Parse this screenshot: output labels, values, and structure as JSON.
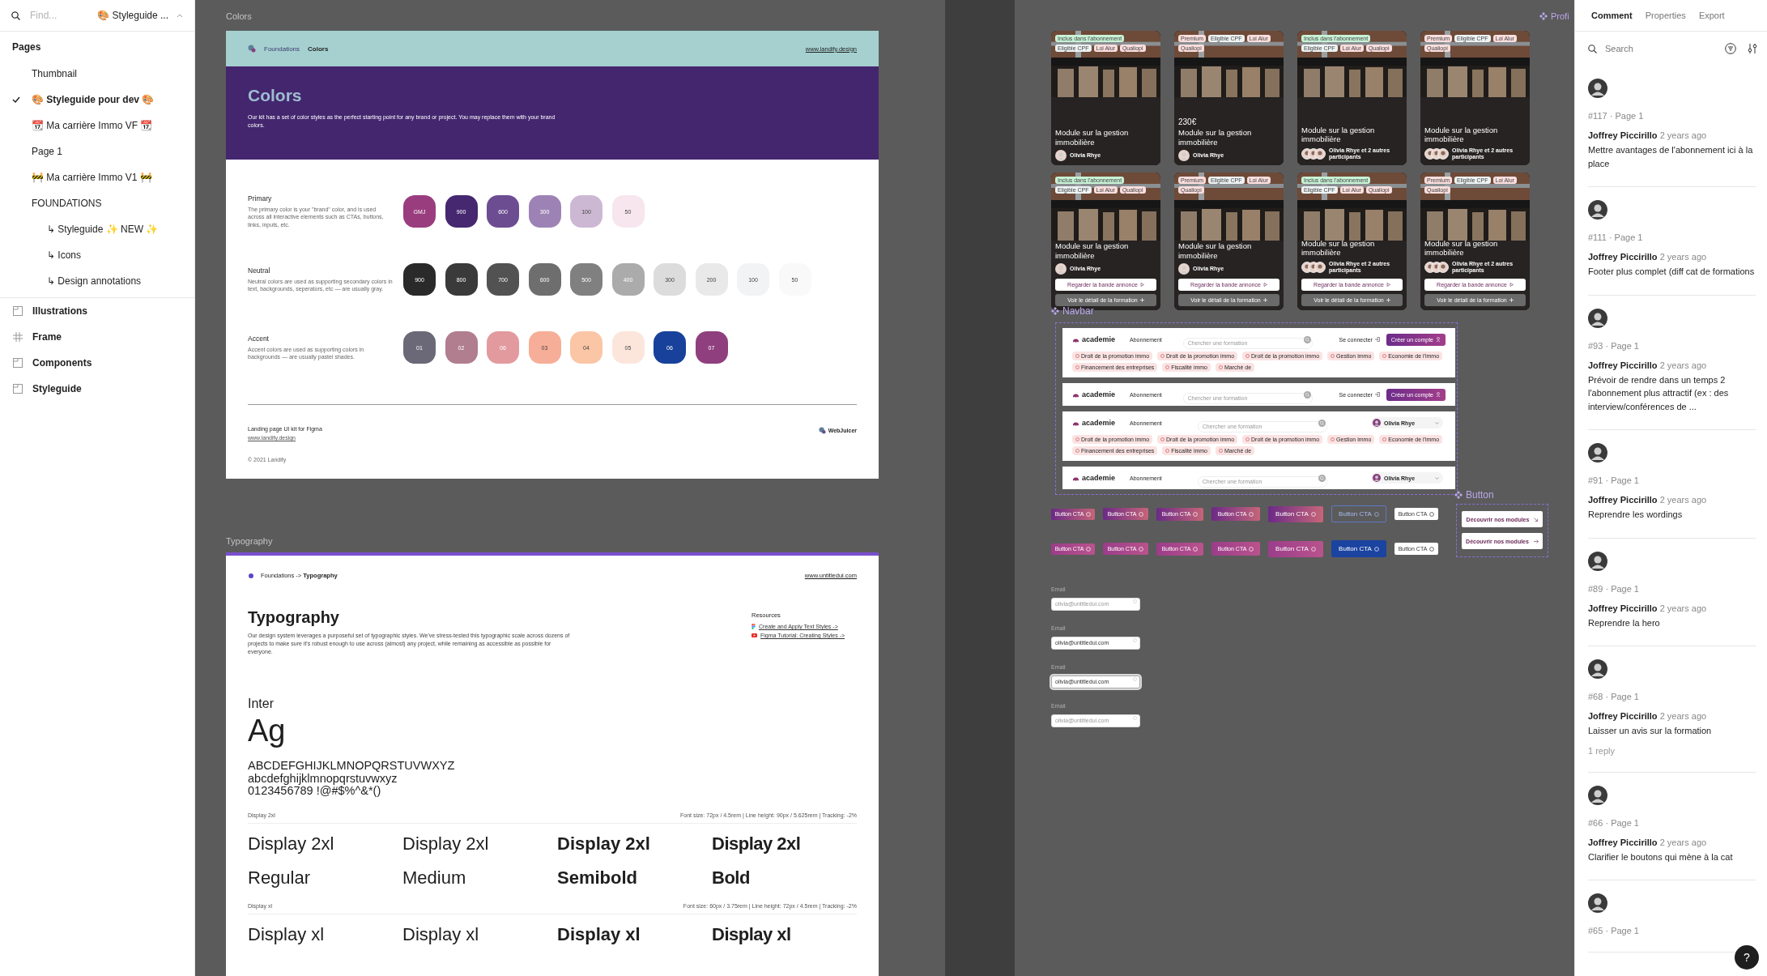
{
  "sidebar": {
    "search": {
      "placeholder": "Find..."
    },
    "file_name": "🎨 Styleguide ...",
    "pages_title": "Pages",
    "pages": [
      {
        "label": "Thumbnail",
        "selected": false
      },
      {
        "label": "🎨 Styleguide pour dev 🎨",
        "selected": true
      },
      {
        "label": "📆 Ma carrière Immo VF 📆",
        "selected": false
      },
      {
        "label": "Page 1",
        "selected": false
      },
      {
        "label": "🚧 Ma carrière Immo V1 🚧",
        "selected": false
      },
      {
        "label": "FOUNDATIONS",
        "selected": false,
        "children": [
          {
            "label": "↳ Styleguide ✨ NEW ✨",
            "selected": false
          },
          {
            "label": "↳ Icons",
            "selected": false
          },
          {
            "label": "↳ Design annotations",
            "selected": false
          }
        ]
      }
    ],
    "layers": [
      {
        "kind": "section",
        "label": "Illustrations"
      },
      {
        "kind": "frame",
        "label": "Frame"
      },
      {
        "kind": "section",
        "label": "Components"
      },
      {
        "kind": "section",
        "label": "Styleguide"
      }
    ]
  },
  "canvas": {
    "colors_frame": {
      "label": "Colors",
      "breadcrumb": [
        "Foundations",
        "Colors"
      ],
      "link": "www.landify.design",
      "title": "Colors",
      "intro": "Our kit has a set of color styles as the perfect starting point for any brand or project. You may replace them with your brand colors.",
      "groups": [
        {
          "name": "Primary",
          "description": "The primary color is your \"brand\" color, and is used across all interactive elements such as CTAs, buttons, links, inputs, etc.",
          "swatches": [
            {
              "label": "GMJ",
              "color": "#9a3d7f"
            },
            {
              "label": "900",
              "color": "#452870"
            },
            {
              "label": "600",
              "color": "#6c4d92"
            },
            {
              "label": "300",
              "color": "#9d83b5"
            },
            {
              "label": "100",
              "color": "#cdb8d4"
            },
            {
              "label": "50",
              "color": "#f7e6ee"
            }
          ]
        },
        {
          "name": "Neutral",
          "description": "Neutral colors are used as supporting secondary colors in text, backgrounds, seperators, etc — are usually gray.",
          "swatches": [
            {
              "label": "900",
              "color": "#2a2a2a"
            },
            {
              "label": "800",
              "color": "#3a3a3a"
            },
            {
              "label": "700",
              "color": "#525252"
            },
            {
              "label": "600",
              "color": "#6e6e6e"
            },
            {
              "label": "500",
              "color": "#808080"
            },
            {
              "label": "400",
              "color": "#ababab"
            },
            {
              "label": "300",
              "color": "#dcdcdc"
            },
            {
              "label": "200",
              "color": "#e9e9e9"
            },
            {
              "label": "100",
              "color": "#f2f3f4"
            },
            {
              "label": "50",
              "color": "#f9f9f9"
            }
          ]
        },
        {
          "name": "Accent",
          "description": "Accent colors are used as supporting colors in backgrounds — are usually pastel shades.",
          "swatches": [
            {
              "label": "01",
              "color": "#6b6877"
            },
            {
              "label": "02",
              "color": "#b07e8e"
            },
            {
              "label": "06",
              "color": "#e39a9f"
            },
            {
              "label": "03",
              "color": "#f7ae98"
            },
            {
              "label": "04",
              "color": "#fbc6a6"
            },
            {
              "label": "05",
              "color": "#fce6dc"
            },
            {
              "label": "06",
              "color": "#17419a"
            },
            {
              "label": "07",
              "color": "#8f3f7e"
            }
          ]
        }
      ],
      "footer": {
        "title": "Landing page UI kit for Figma",
        "link": "www.landify.design",
        "brand": "WebJuicer",
        "copyright": "© 2021 Landify"
      }
    },
    "typography_frame": {
      "label": "Typography",
      "breadcrumb": "Foundations -> **Typography**",
      "link": "www.untitledui.com",
      "title": "Typography",
      "intro": "Our design system leverages a purposeful set of typographic styles. We've stress-tested this typographic scale across dozens of projects to make sure it's robust enough to use across (almost) any project, while remaining as accessible as possible for everyone.",
      "resources": {
        "title": "Resources",
        "links": [
          {
            "label": "Create and Apply Text Styles ->",
            "kind": "figma"
          },
          {
            "label": "Figma Tutorial: Creating Styles ->",
            "kind": "video"
          }
        ]
      },
      "font_name": "Inter",
      "specimen": "Ag",
      "glyphs": [
        "ABCDEFGHIJKLMNOPQRSTUVWXYZ",
        "abcdefghijklmnopqrstuvwxyz",
        "0123456789 !@#$%^&*()"
      ],
      "scales": [
        {
          "name": "Display 2xl",
          "spec": "Font size: 72px / 4.5rem | Line height: 90px / 5.625rem | Tracking: -2%",
          "samples": [
            "Display 2xl",
            "Display 2xl",
            "Display 2xl",
            "Display 2xl"
          ],
          "weights": [
            "Regular",
            "Medium",
            "Semibold",
            "Bold"
          ]
        },
        {
          "name": "Display xl",
          "spec": "Font size: 60px / 3.75rem | Line height: 72px / 4.5rem | Tracking: -2%",
          "samples": [
            "Display xl",
            "Display xl",
            "Display xl",
            "Display xl"
          ]
        }
      ]
    },
    "cards": [
      {
        "tags": [
          {
            "label": "Inclus dans l'abonnement",
            "color": "#c8f3d6"
          },
          {
            "label": "Eligible CPF",
            "color": "#eef3f4"
          },
          {
            "label": "Loi Alur",
            "color": "#fbdede"
          },
          {
            "label": "Qualiopi",
            "color": "#fbdede"
          }
        ],
        "title": "Module sur la gestion immobilière",
        "people": {
          "kind": "single",
          "text": "Olivia Rhye"
        }
      },
      {
        "tags": [
          {
            "label": "Premium",
            "color": "#fbdede"
          },
          {
            "label": "Eligible CPF",
            "color": "#eef3f4"
          },
          {
            "label": "Loi Alur",
            "color": "#fbdede"
          },
          {
            "label": "Qualiopi",
            "color": "#fbdede"
          }
        ],
        "price": "230€",
        "title": "Module sur la gestion immobilière",
        "people": {
          "kind": "single",
          "text": "Olivia Rhye"
        }
      },
      {
        "tags": [
          {
            "label": "Inclus dans l'abonnement",
            "color": "#c8f3d6"
          },
          {
            "label": "Eligible CPF",
            "color": "#eef3f4"
          },
          {
            "label": "Loi Alur",
            "color": "#fbdede"
          },
          {
            "label": "Qualiopi",
            "color": "#fbdede"
          }
        ],
        "title": "Module sur la gestion immobilière",
        "people": {
          "kind": "group",
          "text": "Olivia Rhye et 2 autres participants"
        }
      },
      {
        "tags": [
          {
            "label": "Premium",
            "color": "#fbdede"
          },
          {
            "label": "Eligible CPF",
            "color": "#eef3f4"
          },
          {
            "label": "Loi Alur",
            "color": "#fbdede"
          },
          {
            "label": "Qualiopi",
            "color": "#fbdede"
          }
        ],
        "title": "Module sur la gestion immobilière",
        "people": {
          "kind": "group",
          "text": "Olivia Rhye et 2 autres participants"
        }
      },
      {
        "tags": [
          {
            "label": "Inclus dans l'abonnement",
            "color": "#c8f3d6"
          },
          {
            "label": "Eligible CPF",
            "color": "#eef3f4"
          },
          {
            "label": "Loi Alur",
            "color": "#fbdede"
          },
          {
            "label": "Qualiopi",
            "color": "#fbdede"
          }
        ],
        "title": "Module sur la gestion immobilière",
        "people": {
          "kind": "single",
          "text": "Olivia Rhye"
        },
        "actions": [
          {
            "label": "Regarder la bande annonce",
            "kind": "play"
          },
          {
            "label": "Voir le détail de la formation",
            "kind": "plus"
          }
        ]
      },
      {
        "tags": [
          {
            "label": "Premium",
            "color": "#fbdede"
          },
          {
            "label": "Eligible CPF",
            "color": "#eef3f4"
          },
          {
            "label": "Loi Alur",
            "color": "#fbdede"
          },
          {
            "label": "Qualiopi",
            "color": "#fbdede"
          }
        ],
        "title": "Module sur la gestion immobilière",
        "people": {
          "kind": "single",
          "text": "Olivia Rhye"
        },
        "actions": [
          {
            "label": "Regarder la bande annonce",
            "kind": "play"
          },
          {
            "label": "Voir le détail de la formation",
            "kind": "plus"
          }
        ]
      },
      {
        "tags": [
          {
            "label": "Inclus dans l'abonnement",
            "color": "#c8f3d6"
          },
          {
            "label": "Eligible CPF",
            "color": "#eef3f4"
          },
          {
            "label": "Loi Alur",
            "color": "#fbdede"
          },
          {
            "label": "Qualiopi",
            "color": "#fbdede"
          }
        ],
        "title": "Module sur la gestion immobilière",
        "people": {
          "kind": "group",
          "text": "Olivia Rhye et 2 autres participants"
        },
        "actions": [
          {
            "label": "Regarder la bande annonce",
            "kind": "play"
          },
          {
            "label": "Voir le détail de la formation",
            "kind": "plus"
          }
        ]
      },
      {
        "tags": [
          {
            "label": "Premium",
            "color": "#fbdede"
          },
          {
            "label": "Eligible CPF",
            "color": "#eef3f4"
          },
          {
            "label": "Loi Alur",
            "color": "#fbdede"
          },
          {
            "label": "Qualiopi",
            "color": "#fbdede"
          }
        ],
        "title": "Module sur la gestion immobilière",
        "people": {
          "kind": "group",
          "text": "Olivia Rhye et 2 autres participants"
        },
        "actions": [
          {
            "label": "Regarder la bande annonce",
            "kind": "play"
          },
          {
            "label": "Voir le détail de la formation",
            "kind": "plus"
          }
        ]
      }
    ],
    "navbar_section": {
      "label": "Navbar",
      "navbars": [
        {
          "kind": "guest",
          "logo": "academie",
          "menu": "Abonnement",
          "search": {
            "placeholder": "Chercher une formation"
          },
          "login": "Se connecter",
          "cta": "Créer un compte",
          "chips": [
            "Droit de la promotion immo",
            "Droit de la promotion immo",
            "Droit de la promotion immo",
            "Gestion immo",
            "Economie de l'immo",
            "Financement des entreprises",
            "Fiscalité immo",
            "Marché de"
          ]
        },
        {
          "kind": "guest",
          "logo": "academie",
          "menu": "Abonnement",
          "search": {
            "placeholder": "Chercher une formation"
          },
          "login": "Se connecter",
          "cta": "Créer un compte"
        },
        {
          "kind": "user",
          "logo": "academie",
          "menu": "Abonnement",
          "search": {
            "placeholder": "Chercher une formation"
          },
          "user": "Olivia Rhye",
          "chips": [
            "Droit de la promotion immo",
            "Droit de la promotion immo",
            "Droit de la promotion immo",
            "Gestion immo",
            "Economie de l'immo",
            "Financement des entreprises",
            "Fiscalité immo",
            "Marché de"
          ]
        },
        {
          "kind": "user",
          "logo": "academie",
          "menu": "Abonnement",
          "search": {
            "placeholder": "Chercher une formation"
          },
          "user": "Olivia Rhye"
        }
      ]
    },
    "button_rows": [
      {
        "buttons": [
          {
            "label": "Button CTA",
            "kind": "gradient"
          },
          {
            "label": "Button CTA",
            "kind": "gradient"
          },
          {
            "label": "Button CTA",
            "kind": "gradient"
          },
          {
            "label": "Button CTA",
            "kind": "gradient"
          },
          {
            "label": "Button CTA",
            "kind": "gradient"
          },
          {
            "label": "Button CTA",
            "kind": "outline"
          },
          {
            "label": "Button CTA",
            "kind": "white"
          }
        ]
      },
      {
        "buttons": [
          {
            "label": "Button CTA",
            "kind": "pink"
          },
          {
            "label": "Button CTA",
            "kind": "pink"
          },
          {
            "label": "Button CTA",
            "kind": "pink"
          },
          {
            "label": "Button CTA",
            "kind": "pink"
          },
          {
            "label": "Button CTA",
            "kind": "pink"
          },
          {
            "label": "Button CTA",
            "kind": "blue"
          },
          {
            "label": "Button CTA",
            "kind": "white"
          }
        ]
      }
    ],
    "button_section": {
      "label": "Button",
      "buttons": [
        {
          "label": "Découvrir nos modules",
          "kind": "diagonal"
        },
        {
          "label": "Découvrir nos modules",
          "kind": "arrow"
        }
      ]
    },
    "inputs": [
      {
        "label": "Email",
        "placeholder": "olivia@untitledui.com",
        "focused": false
      },
      {
        "label": "Email",
        "value": "olivia@untitledui.com",
        "focused": false
      },
      {
        "label": "Email",
        "value": "olivia@untitledui.com",
        "focused": true
      },
      {
        "label": "Email",
        "placeholder": "olivia@untitledui.com",
        "focused": false
      }
    ],
    "profile_label": "Profi"
  },
  "comments_panel": {
    "tabs": [
      {
        "label": "Comment",
        "selected": true
      },
      {
        "label": "Properties",
        "selected": false
      },
      {
        "label": "Export",
        "selected": false
      }
    ],
    "search": {
      "placeholder": "Search"
    },
    "comments": [
      {
        "ref": "#117 · Page 1",
        "author": "Joffrey Piccirillo",
        "time": "2 years ago",
        "text": "Mettre avantages de l'abonnement ici à la place"
      },
      {
        "ref": "#111 · Page 1",
        "author": "Joffrey Piccirillo",
        "time": "2 years ago",
        "text": "Footer plus complet (diff cat de formations"
      },
      {
        "ref": "#93 · Page 1",
        "author": "Joffrey Piccirillo",
        "time": "2 years ago",
        "text": "Prévoir de rendre dans un temps 2 l'abonnement plus attractif (ex : des interview/conférences de ..."
      },
      {
        "ref": "#91 · Page 1",
        "author": "Joffrey Piccirillo",
        "time": "2 years ago",
        "text": "Reprendre les wordings"
      },
      {
        "ref": "#89 · Page 1",
        "author": "Joffrey Piccirillo",
        "time": "2 years ago",
        "text": "Reprendre la hero"
      },
      {
        "ref": "#68 · Page 1",
        "author": "Joffrey Piccirillo",
        "time": "2 years ago",
        "text": "Laisser un avis sur la formation",
        "replies": "1 reply"
      },
      {
        "ref": "#66 · Page 1",
        "author": "Joffrey Piccirillo",
        "time": "2 years ago",
        "text": "Clarifier le boutons qui mène à la cat"
      },
      {
        "ref": "#65 · Page 1"
      }
    ],
    "help": "?"
  }
}
